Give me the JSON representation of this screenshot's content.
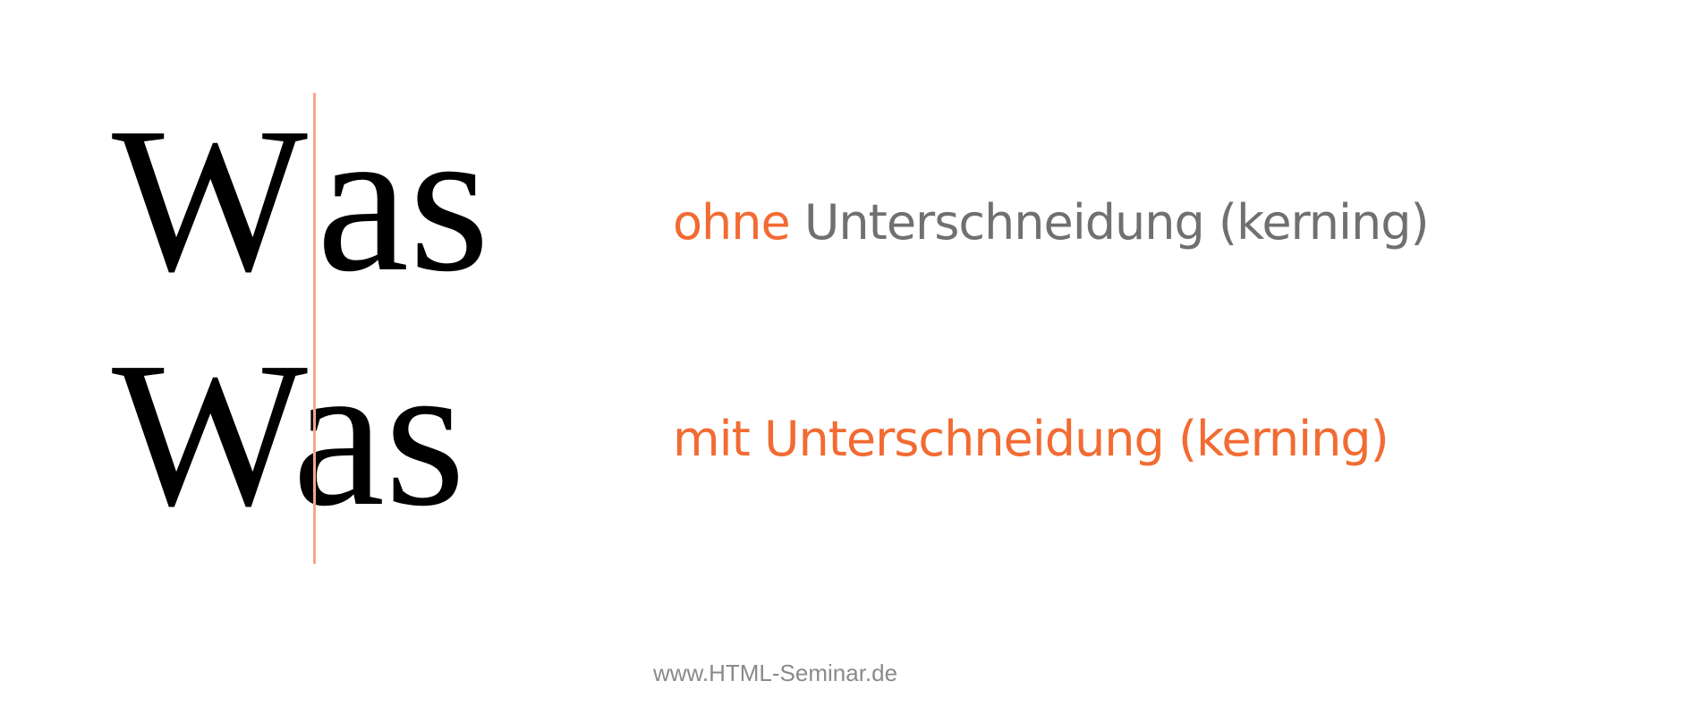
{
  "samples": [
    {
      "first_letter": "W",
      "rest": "as"
    },
    {
      "first_letter": "W",
      "rest": "as"
    }
  ],
  "captions": {
    "without": {
      "accent": "ohne",
      "text": "Unterschneidung (kerning)"
    },
    "with": {
      "text": "mit Unterschneidung (kerning)"
    }
  },
  "footer": {
    "text": "www.HTML-Seminar.de"
  },
  "colors": {
    "accent": "#f26b32",
    "guide_line": "#f6a58b",
    "caption_gray": "#707070",
    "sample_text": "#000000",
    "footer_text": "#8a8a8a"
  }
}
